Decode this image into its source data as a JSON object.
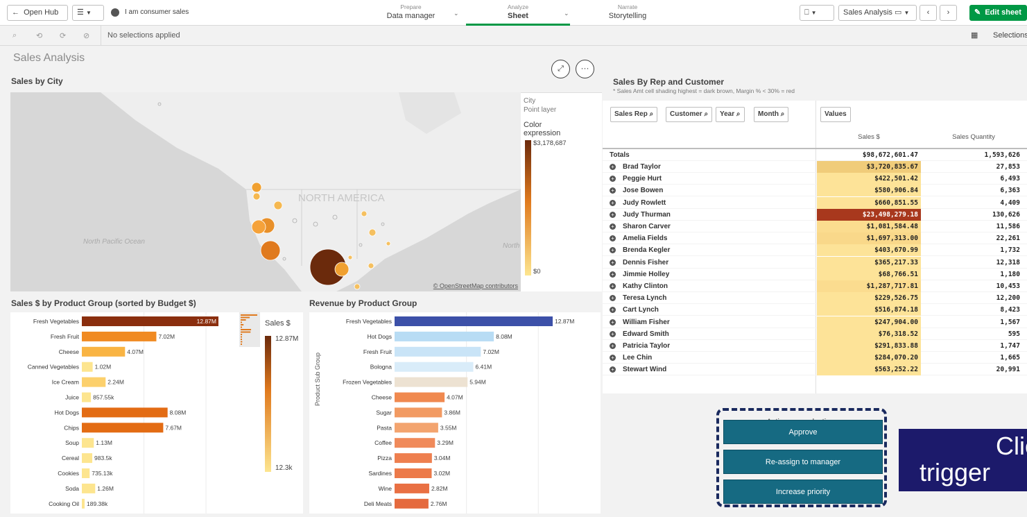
{
  "topbar": {
    "open_hub": "Open Hub",
    "user": "I am consumer sales",
    "nav": [
      {
        "small": "Prepare",
        "big": "Data manager"
      },
      {
        "small": "Analyze",
        "big": "Sheet"
      },
      {
        "small": "Narrate",
        "big": "Storytelling"
      }
    ],
    "sheet_name": "Sales Analysis",
    "edit_sheet": "Edit sheet"
  },
  "selbar": {
    "status": "No selections applied",
    "selections": "Selections"
  },
  "sheet_title": "Sales Analysis",
  "map": {
    "title": "Sales by City",
    "label_continent": "NORTH AMERICA",
    "label_ocean": "North Pacific Ocean",
    "label_edge": "North",
    "attribution": "© OpenStreetMap contributors",
    "legend": {
      "layer1": "City",
      "layer2": "Point layer",
      "color_title": "Color expression",
      "max": "$3,178,687",
      "min": "$0"
    }
  },
  "table": {
    "title": "Sales By Rep and Customer",
    "subtitle": "* Sales Amt cell shading highest = dark brown, Margin % < 30% = red",
    "filters": [
      "Sales Rep",
      "Customer",
      "Year",
      "Month"
    ],
    "values_btn": "Values",
    "columns": [
      "Sales $",
      "Sales Quantity"
    ],
    "totals_label": "Totals",
    "totals": [
      "$98,672,601.47",
      "1,593,626"
    ],
    "rows": [
      {
        "name": "Brad Taylor",
        "sales": "$3,720,835.67",
        "qty": "27,853",
        "color": "#f0cc7a"
      },
      {
        "name": "Peggie Hurt",
        "sales": "$422,501.42",
        "qty": "6,493",
        "color": "#fde398"
      },
      {
        "name": "Jose Bowen",
        "sales": "$580,906.84",
        "qty": "6,363",
        "color": "#fde398"
      },
      {
        "name": "Judy Rowlett",
        "sales": "$660,851.55",
        "qty": "4,409",
        "color": "#fde398"
      },
      {
        "name": "Judy Thurman",
        "sales": "$23,498,279.18",
        "qty": "130,626",
        "color": "#a8381d"
      },
      {
        "name": "Sharon Carver",
        "sales": "$1,081,584.48",
        "qty": "11,586",
        "color": "#fbdc8f"
      },
      {
        "name": "Amelia Fields",
        "sales": "$1,697,313.00",
        "qty": "22,261",
        "color": "#f9d88a"
      },
      {
        "name": "Brenda Kegler",
        "sales": "$403,670.99",
        "qty": "1,732",
        "color": "#fde398"
      },
      {
        "name": "Dennis Fisher",
        "sales": "$365,217.33",
        "qty": "12,318",
        "color": "#fde398"
      },
      {
        "name": "Jimmie Holley",
        "sales": "$68,766.51",
        "qty": "1,180",
        "color": "#fde398"
      },
      {
        "name": "Kathy Clinton",
        "sales": "$1,287,717.81",
        "qty": "10,453",
        "color": "#fbdc8f"
      },
      {
        "name": "Teresa Lynch",
        "sales": "$229,526.75",
        "qty": "12,200",
        "color": "#fde398"
      },
      {
        "name": "Cart Lynch",
        "sales": "$516,874.18",
        "qty": "8,423",
        "color": "#fde398"
      },
      {
        "name": "William Fisher",
        "sales": "$247,904.00",
        "qty": "1,567",
        "color": "#fde398"
      },
      {
        "name": "Edward Smith",
        "sales": "$76,318.52",
        "qty": "595",
        "color": "#fde398"
      },
      {
        "name": "Patricia Taylor",
        "sales": "$291,833.88",
        "qty": "1,747",
        "color": "#fde398"
      },
      {
        "name": "Lee Chin",
        "sales": "$284,070.20",
        "qty": "1,665",
        "color": "#fde398"
      },
      {
        "name": "Stewart Wind",
        "sales": "$563,252.22",
        "qty": "20,991",
        "color": "#fde398"
      }
    ]
  },
  "chart_data": [
    {
      "type": "bar",
      "title": "Sales $ by Product Group (sorted by Budget $)",
      "categories": [
        "Fresh Vegetables",
        "Fresh Fruit",
        "Cheese",
        "Canned Vegetables",
        "Ice Cream",
        "Juice",
        "Hot Dogs",
        "Chips",
        "Soup",
        "Cereal",
        "Cookies",
        "Soda",
        "Cooking Oil"
      ],
      "values": [
        12870000,
        7020000,
        4070000,
        1020000,
        2240000,
        857550,
        8080000,
        7670000,
        1130000,
        983500,
        735130,
        1260000,
        189380
      ],
      "value_labels": [
        "12.87M",
        "7.02M",
        "4.07M",
        "1.02M",
        "2.24M",
        "857.55k",
        "8.08M",
        "7.67M",
        "1.13M",
        "983.5k",
        "735.13k",
        "1.26M",
        "189.38k"
      ],
      "legend": {
        "title": "Sales $",
        "max": "12.87M",
        "min": "12.3k"
      }
    },
    {
      "type": "bar",
      "title": "Revenue by Product Group",
      "ylabel": "Product Sub Group",
      "categories": [
        "Fresh Vegetables",
        "Hot Dogs",
        "Fresh Fruit",
        "Bologna",
        "Frozen Vegetables",
        "Cheese",
        "Sugar",
        "Pasta",
        "Coffee",
        "Pizza",
        "Sardines",
        "Wine",
        "Deli Meats"
      ],
      "values": [
        12870000,
        8080000,
        7020000,
        6410000,
        5940000,
        4070000,
        3860000,
        3550000,
        3290000,
        3040000,
        3020000,
        2820000,
        2760000
      ],
      "value_labels": [
        "12.87M",
        "8.08M",
        "7.02M",
        "6.41M",
        "5.94M",
        "4.07M",
        "3.86M",
        "3.55M",
        "3.29M",
        "3.04M",
        "3.02M",
        "2.82M",
        "2.76M"
      ]
    }
  ],
  "actions": {
    "title": "Actions on selection:",
    "buttons": [
      "Approve",
      "Re-assign to manager",
      "Increase priority"
    ]
  },
  "callout": {
    "line1": "Clic",
    "line2": "trigger"
  }
}
